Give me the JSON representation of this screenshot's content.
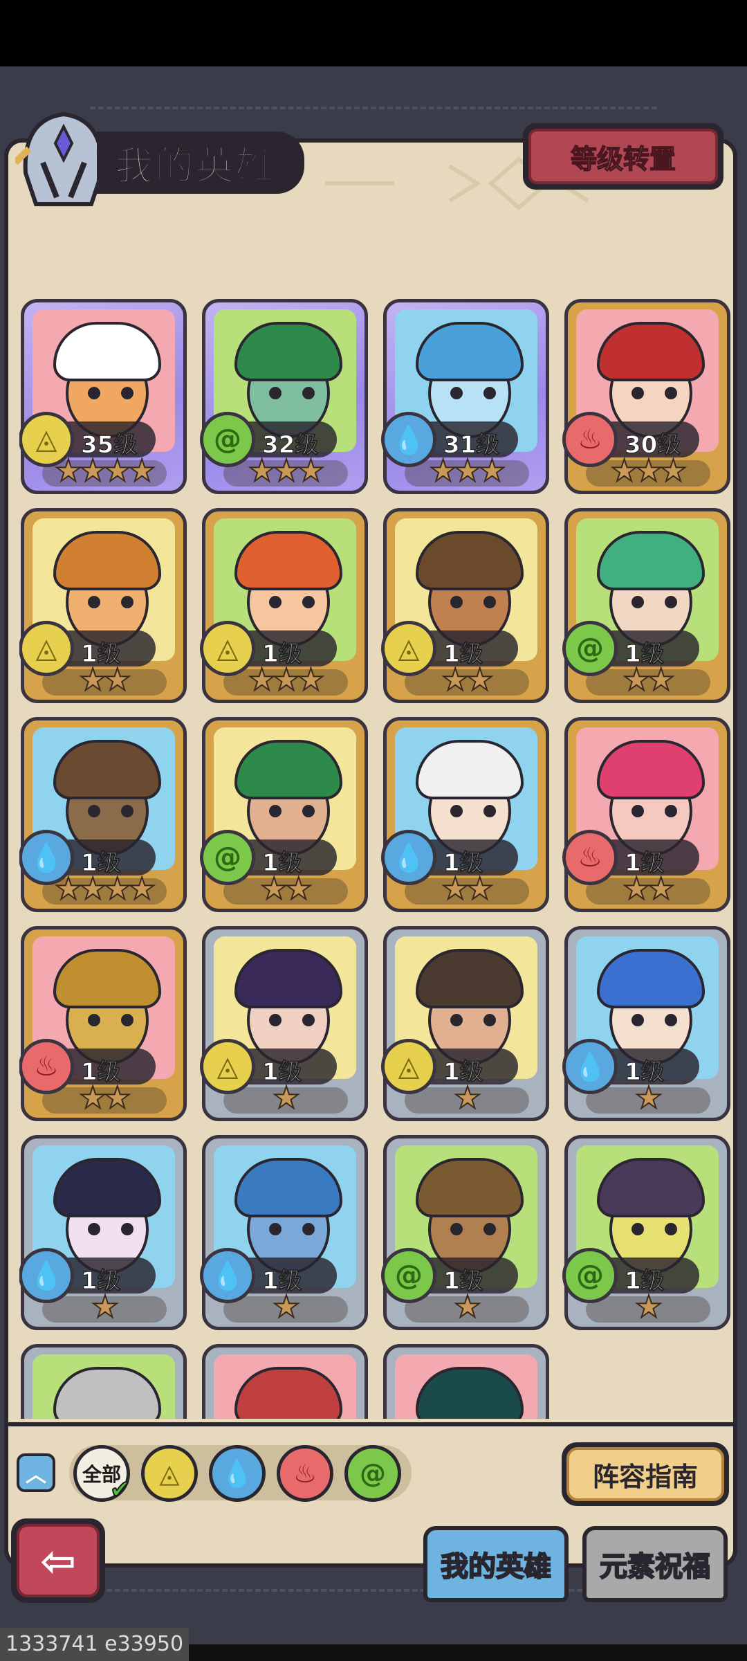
{
  "header": {
    "title": "我的英雄",
    "transfer_button": "等级转置"
  },
  "heroes": [
    {
      "level": "35级",
      "stars": "★★★★",
      "element": "earth"
    },
    {
      "level": "32级",
      "stars": "★★★",
      "element": "wind"
    },
    {
      "level": "31级",
      "stars": "★★★",
      "element": "water"
    },
    {
      "level": "30级",
      "stars": "★★★",
      "element": "fire"
    },
    {
      "level": "1级",
      "stars": "★★",
      "element": "earth"
    },
    {
      "level": "1级",
      "stars": "★★★",
      "element": "earth"
    },
    {
      "level": "1级",
      "stars": "★★",
      "element": "earth"
    },
    {
      "level": "1级",
      "stars": "★★",
      "element": "wind"
    },
    {
      "level": "1级",
      "stars": "★★★★",
      "element": "water"
    },
    {
      "level": "1级",
      "stars": "★★",
      "element": "wind"
    },
    {
      "level": "1级",
      "stars": "★★",
      "element": "water"
    },
    {
      "level": "1级",
      "stars": "★★",
      "element": "fire"
    },
    {
      "level": "1级",
      "stars": "★★",
      "element": "fire"
    },
    {
      "level": "1级",
      "stars": "★",
      "element": "earth"
    },
    {
      "level": "1级",
      "stars": "★",
      "element": "earth"
    },
    {
      "level": "1级",
      "stars": "★",
      "element": "water"
    },
    {
      "level": "1级",
      "stars": "★",
      "element": "water"
    },
    {
      "level": "1级",
      "stars": "★",
      "element": "water"
    },
    {
      "level": "1级",
      "stars": "★",
      "element": "wind"
    },
    {
      "level": "1级",
      "stars": "★",
      "element": "wind"
    }
  ],
  "filters": {
    "all_label": "全部"
  },
  "guide_button": "阵容指南",
  "tabs": {
    "my_heroes": "我的英雄",
    "element_blessing": "元素祝福"
  },
  "footer_id": "1333741 e33950",
  "colors": {
    "gold_frame": "#d6a34a",
    "purple_frame": "#9a8ae8",
    "silver_frame": "#a9b3bf",
    "tab_active": "#6fb4e0"
  }
}
